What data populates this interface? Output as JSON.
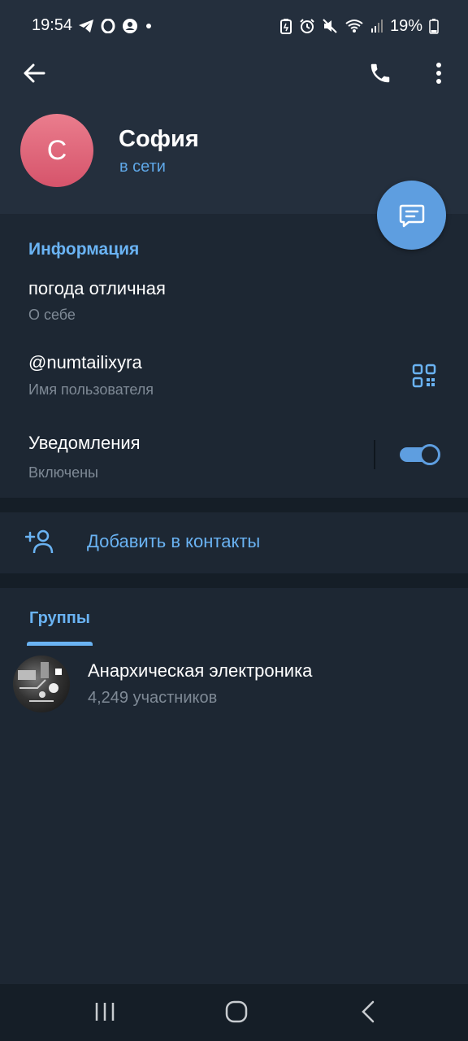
{
  "status_bar": {
    "time": "19:54",
    "battery": "19%"
  },
  "profile": {
    "avatar_letter": "С",
    "name": "София",
    "status": "в сети"
  },
  "info": {
    "section_title": "Информация",
    "bio_value": "погода отличная",
    "bio_label": "О себе",
    "username_value": "@numtailixyra",
    "username_label": "Имя пользователя",
    "notifications_label": "Уведомления",
    "notifications_status": "Включены",
    "notifications_on": true
  },
  "actions": {
    "add_contact": "Добавить в контакты"
  },
  "groups": {
    "tab_label": "Группы",
    "items": [
      {
        "name": "Анархическая электроника",
        "members": "4,249 участников"
      }
    ]
  },
  "icons": {
    "back": "arrow-left",
    "call": "phone",
    "more": "vertical-dots",
    "message": "chat-bubble",
    "qr": "qr-code",
    "add_contact": "person-plus"
  },
  "colors": {
    "accent": "#6ab3f3",
    "fab": "#5e9ee0",
    "avatar": "#e0687c",
    "background": "#1d2733",
    "header": "#242f3d"
  }
}
